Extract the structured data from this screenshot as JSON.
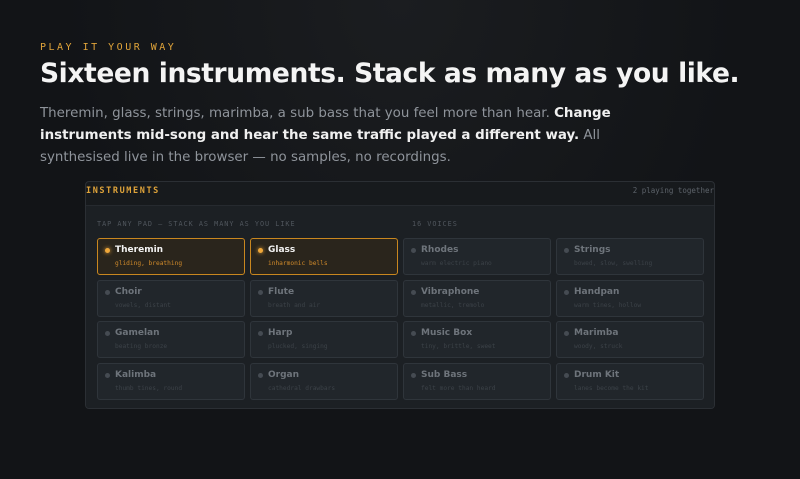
{
  "hero": {
    "eyebrow": "PLAY IT YOUR WAY",
    "headline": "Sixteen instruments. Stack as many as you like.",
    "desc_intro": "Theremin, glass, strings, marimba, a sub bass that you feel more than hear.",
    "desc_bold": "Change instruments mid-song and hear the same traffic played a different way.",
    "desc_outro": "All synthesised live in the browser — no samples, no recordings."
  },
  "panel": {
    "title": "INSTRUMENTS",
    "status": "2 playing together",
    "hint_left": "TAP ANY PAD — STACK AS MANY AS YOU LIKE",
    "hint_right": "16 VOICES"
  },
  "colors": {
    "accent": "#e0a43a",
    "active_border": "#c9871f"
  },
  "instruments": [
    {
      "name": "Theremin",
      "desc": "gliding, breathing",
      "active": true
    },
    {
      "name": "Glass",
      "desc": "inharmonic bells",
      "active": true
    },
    {
      "name": "Rhodes",
      "desc": "warm electric piano",
      "active": false
    },
    {
      "name": "Strings",
      "desc": "bowed, slow, swelling",
      "active": false
    },
    {
      "name": "Choir",
      "desc": "vowels, distant",
      "active": false
    },
    {
      "name": "Flute",
      "desc": "breath and air",
      "active": false
    },
    {
      "name": "Vibraphone",
      "desc": "metallic, tremolo",
      "active": false
    },
    {
      "name": "Handpan",
      "desc": "warm tines, hollow",
      "active": false
    },
    {
      "name": "Gamelan",
      "desc": "beating bronze",
      "active": false
    },
    {
      "name": "Harp",
      "desc": "plucked, singing",
      "active": false
    },
    {
      "name": "Music Box",
      "desc": "tiny, brittle, sweet",
      "active": false
    },
    {
      "name": "Marimba",
      "desc": "woody, struck",
      "active": false
    },
    {
      "name": "Kalimba",
      "desc": "thumb tines, round",
      "active": false
    },
    {
      "name": "Organ",
      "desc": "cathedral drawbars",
      "active": false
    },
    {
      "name": "Sub Bass",
      "desc": "felt more than heard",
      "active": false
    },
    {
      "name": "Drum Kit",
      "desc": "lanes become the kit",
      "active": false
    }
  ]
}
